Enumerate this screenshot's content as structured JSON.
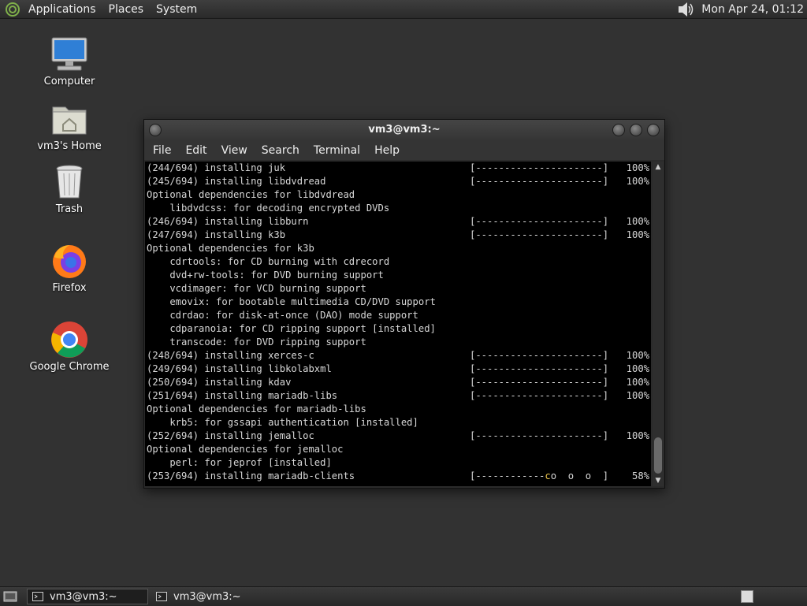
{
  "top_panel": {
    "menus": [
      "Applications",
      "Places",
      "System"
    ],
    "clock": "Mon Apr 24, 01:12"
  },
  "desktop": {
    "icons": [
      {
        "label": "Computer",
        "icon": "computer-icon"
      },
      {
        "label": "vm3's Home",
        "icon": "home-folder-icon"
      },
      {
        "label": "Trash",
        "icon": "trash-icon"
      },
      {
        "label": "Firefox",
        "icon": "firefox-icon"
      },
      {
        "label": "Google Chrome",
        "icon": "chrome-icon"
      }
    ]
  },
  "terminal": {
    "title": "vm3@vm3:~",
    "menus": [
      "File",
      "Edit",
      "View",
      "Search",
      "Terminal",
      "Help"
    ],
    "lines": [
      {
        "text": "(244/694) installing juk",
        "bar": "[----------------------]",
        "pct": "100%"
      },
      {
        "text": "(245/694) installing libdvdread",
        "bar": "[----------------------]",
        "pct": "100%"
      },
      {
        "text": "Optional dependencies for libdvdread"
      },
      {
        "text": "    libdvdcss: for decoding encrypted DVDs"
      },
      {
        "text": "(246/694) installing libburn",
        "bar": "[----------------------]",
        "pct": "100%"
      },
      {
        "text": "(247/694) installing k3b",
        "bar": "[----------------------]",
        "pct": "100%"
      },
      {
        "text": "Optional dependencies for k3b"
      },
      {
        "text": "    cdrtools: for CD burning with cdrecord"
      },
      {
        "text": "    dvd+rw-tools: for DVD burning support"
      },
      {
        "text": "    vcdimager: for VCD burning support"
      },
      {
        "text": "    emovix: for bootable multimedia CD/DVD support"
      },
      {
        "text": "    cdrdao: for disk-at-once (DAO) mode support"
      },
      {
        "text": "    cdparanoia: for CD ripping support [installed]"
      },
      {
        "text": "    transcode: for DVD ripping support"
      },
      {
        "text": "(248/694) installing xerces-c",
        "bar": "[----------------------]",
        "pct": "100%"
      },
      {
        "text": "(249/694) installing libkolabxml",
        "bar": "[----------------------]",
        "pct": "100%"
      },
      {
        "text": "(250/694) installing kdav",
        "bar": "[----------------------]",
        "pct": "100%"
      },
      {
        "text": "(251/694) installing mariadb-libs",
        "bar": "[----------------------]",
        "pct": "100%"
      },
      {
        "text": "Optional dependencies for mariadb-libs"
      },
      {
        "text": "    krb5: for gssapi authentication [installed]"
      },
      {
        "text": "(252/694) installing jemalloc",
        "bar": "[----------------------]",
        "pct": "100%"
      },
      {
        "text": "Optional dependencies for jemalloc"
      },
      {
        "text": "    perl: for jeprof [installed]"
      },
      {
        "text": "(253/694) installing mariadb-clients",
        "bar_done": "[------------",
        "bar_pac": "c",
        "bar_rest": "o  o  o  ]",
        "pct": "58%"
      }
    ]
  },
  "bottom_panel": {
    "tasks": [
      {
        "label": "vm3@vm3:~",
        "active": true
      },
      {
        "label": "vm3@vm3:~",
        "active": false
      }
    ]
  },
  "colors": {
    "desktop_bg": "#323232",
    "terminal_bg": "#000000",
    "terminal_fg": "#d8d8d8",
    "progress_accent": "#e8c24a"
  }
}
